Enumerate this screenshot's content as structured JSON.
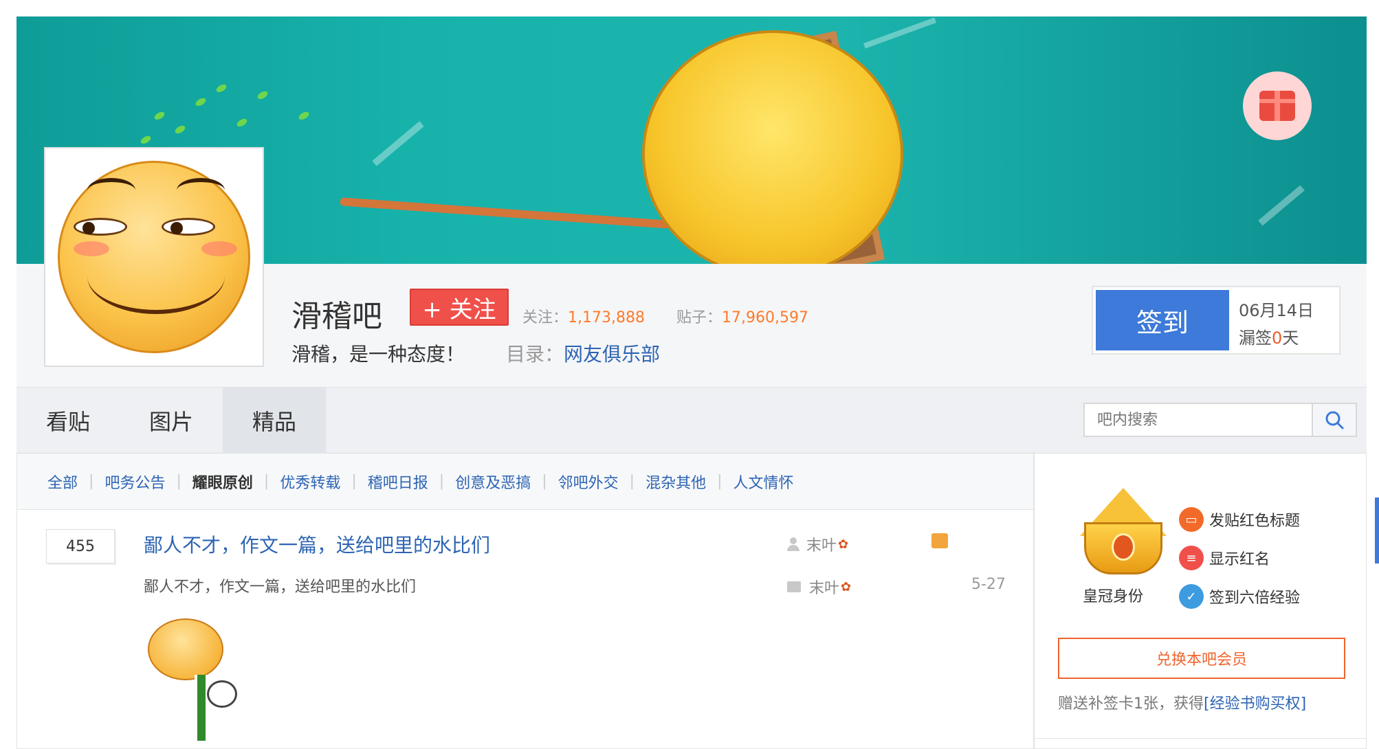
{
  "header": {
    "forum_name": "滑稽吧",
    "follow_label": "+ 关注",
    "follow_count_label": "关注：",
    "follow_count": "1,173,888",
    "post_count_label": "贴子：",
    "post_count": "17,960,597",
    "slogan": "滑稽，是一种态度！",
    "catalog_label": "目录：",
    "catalog_link": "网友俱乐部"
  },
  "signin": {
    "button_label": "签到",
    "date": "06月14日",
    "missed_prefix": "漏签",
    "missed_days": "0",
    "missed_suffix": "天"
  },
  "tabs": [
    {
      "label": "看贴",
      "active": false
    },
    {
      "label": "图片",
      "active": false
    },
    {
      "label": "精品",
      "active": true
    }
  ],
  "search": {
    "placeholder": "吧内搜索"
  },
  "categories": [
    {
      "label": "全部",
      "bold": false
    },
    {
      "label": "吧务公告",
      "bold": false
    },
    {
      "label": "耀眼原创",
      "bold": true
    },
    {
      "label": "优秀转载",
      "bold": false
    },
    {
      "label": "稽吧日报",
      "bold": false
    },
    {
      "label": "创意及恶搞",
      "bold": false
    },
    {
      "label": "邻吧外交",
      "bold": false
    },
    {
      "label": "混杂其他",
      "bold": false
    },
    {
      "label": "人文情怀",
      "bold": false
    }
  ],
  "post": {
    "reply_count": "455",
    "title": "鄙人不才，作文一篇，送给吧里的水比们",
    "abstract": "鄙人不才，作文一篇，送给吧里的水比们",
    "author": "末叶",
    "last_reply_author": "末叶",
    "time": "5-27"
  },
  "sidebar": {
    "crown_label": "皇冠身份",
    "perks": [
      {
        "label": "发贴红色标题",
        "icon": "red-title-icon",
        "color": "#f26a2a"
      },
      {
        "label": "显示红名",
        "icon": "red-name-icon",
        "color": "#f0504a"
      },
      {
        "label": "签到六倍经验",
        "icon": "sign-exp-icon",
        "color": "#3d9be0"
      }
    ],
    "exchange_label": "兑换本吧会员",
    "bonus_text": "赠送补签卡1张，获得",
    "bonus_link": "[经验书购买权]"
  },
  "colors": {
    "accent_blue": "#3d7ad9",
    "link_blue": "#2d64b3",
    "follow_red": "#f0504a",
    "stat_orange": "#ff7a28"
  }
}
